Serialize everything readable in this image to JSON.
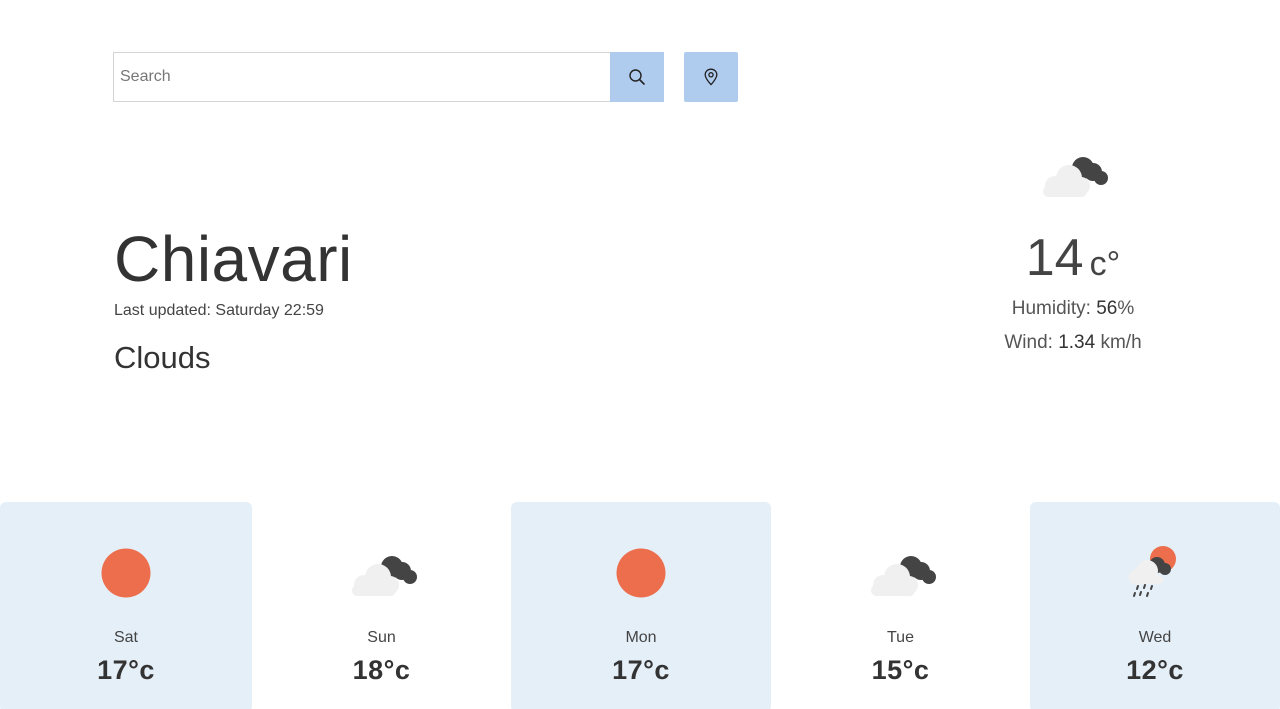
{
  "colors": {
    "button_bg": "#afcbed",
    "card_bg": "#e5eff8",
    "sun": "#ec6e4c",
    "cloud_light": "#f0f0f0",
    "cloud_dark": "#444444"
  },
  "search": {
    "placeholder": "Search",
    "value": "",
    "search_icon": "search-icon",
    "location_icon": "map-pin-icon"
  },
  "current": {
    "city": "Chiavari",
    "last_updated": "Last updated: Saturday 22:59",
    "condition": "Clouds",
    "icon": "clouds-night-icon",
    "temperature": "14",
    "unit": "c°",
    "humidity_label": "Humidity:",
    "humidity_value": "56",
    "humidity_unit": "%",
    "wind_label": "Wind:",
    "wind_value": "1.34",
    "wind_unit": "km/h"
  },
  "forecast": [
    {
      "day": "Sat",
      "temp": "17°c",
      "icon": "sun-icon",
      "highlighted": true
    },
    {
      "day": "Sun",
      "temp": "18°c",
      "icon": "clouds-night-icon",
      "highlighted": false
    },
    {
      "day": "Mon",
      "temp": "17°c",
      "icon": "sun-icon",
      "highlighted": true
    },
    {
      "day": "Tue",
      "temp": "15°c",
      "icon": "clouds-night-icon",
      "highlighted": false
    },
    {
      "day": "Wed",
      "temp": "12°c",
      "icon": "rain-sun-icon",
      "highlighted": true
    }
  ]
}
